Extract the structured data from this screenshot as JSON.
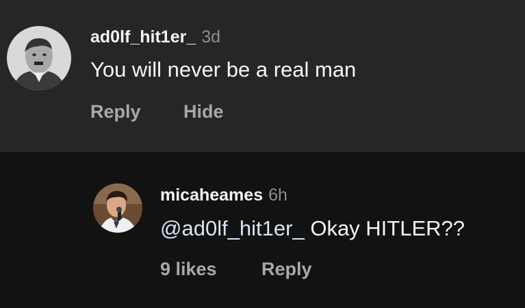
{
  "comment": {
    "username": "ad0lf_hit1er_",
    "time": "3d",
    "text": "You will never be a real man",
    "actions": {
      "reply": "Reply",
      "hide": "Hide"
    }
  },
  "reply": {
    "username": "micaheames",
    "time": "6h",
    "mention": "@ad0lf_hit1er_",
    "text": " Okay HITLER??",
    "likes": "9 likes",
    "actions": {
      "reply": "Reply"
    }
  },
  "colors": {
    "comment_bg": "#262626",
    "reply_bg": "#121212",
    "mention": "#d8e4f6",
    "secondary_text": "#a8a8a8"
  }
}
